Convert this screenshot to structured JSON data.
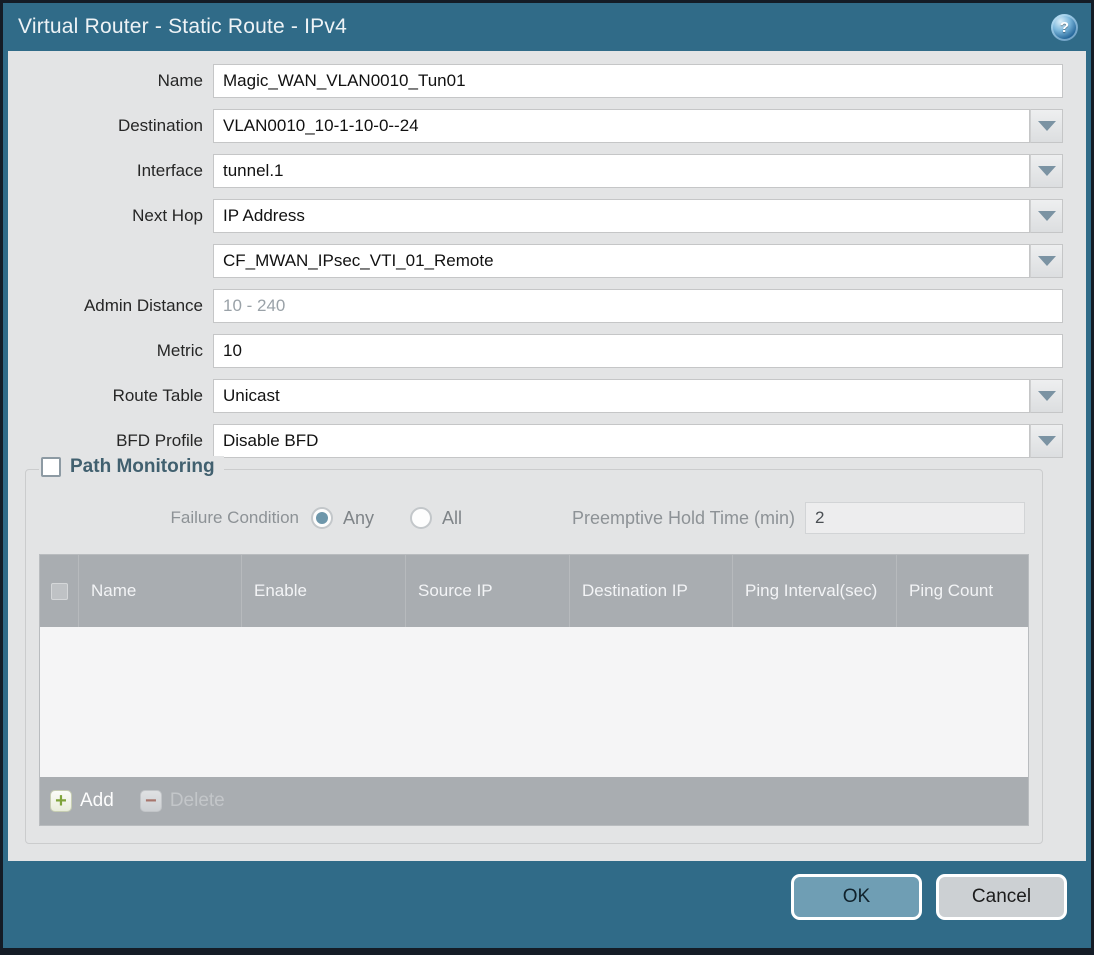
{
  "titlebar": {
    "title": "Virtual Router - Static Route - IPv4",
    "help_glyph": "?"
  },
  "form": {
    "name": {
      "label": "Name",
      "value": "Magic_WAN_VLAN0010_Tun01"
    },
    "destination": {
      "label": "Destination",
      "value": "VLAN0010_10-1-10-0--24"
    },
    "interface": {
      "label": "Interface",
      "value": "tunnel.1"
    },
    "next_hop": {
      "label": "Next Hop",
      "value": "IP Address"
    },
    "next_hop_address": {
      "value": "CF_MWAN_IPsec_VTI_01_Remote"
    },
    "admin_distance": {
      "label": "Admin Distance",
      "value": "",
      "placeholder": "10 - 240"
    },
    "metric": {
      "label": "Metric",
      "value": "10"
    },
    "route_table": {
      "label": "Route Table",
      "value": "Unicast"
    },
    "bfd_profile": {
      "label": "BFD Profile",
      "value": "Disable BFD"
    }
  },
  "path_monitoring": {
    "legend": "Path Monitoring",
    "enabled": false,
    "failure_condition": {
      "label": "Failure Condition",
      "options": [
        {
          "label": "Any",
          "selected": true
        },
        {
          "label": "All",
          "selected": false
        }
      ]
    },
    "preemptive_hold_time": {
      "label": "Preemptive Hold Time (min)",
      "value": "2"
    },
    "table": {
      "columns": [
        "Name",
        "Enable",
        "Source IP",
        "Destination IP",
        "Ping Interval(sec)",
        "Ping Count"
      ],
      "rows": []
    },
    "actions": {
      "add": "Add",
      "delete": "Delete"
    }
  },
  "footer": {
    "ok": "OK",
    "cancel": "Cancel"
  },
  "colors": {
    "chrome_teal": "#306b88",
    "panel_gray": "#e3e4e5",
    "table_header_gray": "#a9adb1",
    "ok_button": "#6f9eb4",
    "radio_selected": "#6e97ab",
    "add_icon_green": "#7fa33a",
    "delete_icon_red": "#a8766d"
  }
}
